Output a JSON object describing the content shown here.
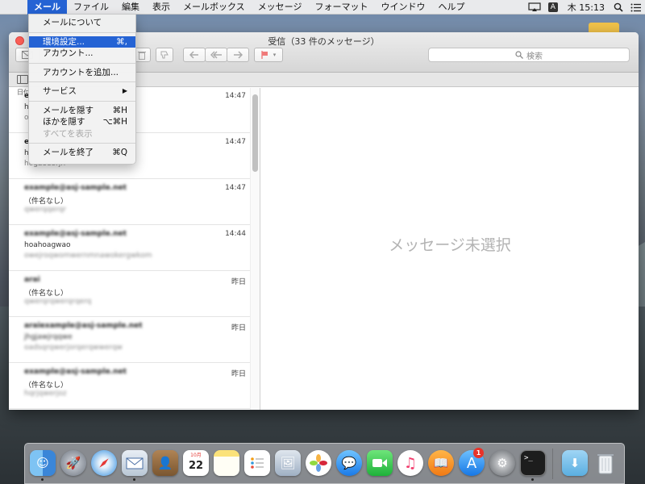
{
  "menubar": {
    "items": [
      "メール",
      "ファイル",
      "編集",
      "表示",
      "メールボックス",
      "メッセージ",
      "フォーマット",
      "ウインドウ",
      "ヘルプ"
    ],
    "ime": "A",
    "clock": "木 15:13"
  },
  "app_menu": {
    "items": [
      {
        "label": "メールについて",
        "shortcut": ""
      },
      {
        "label": "環境設定...",
        "shortcut": "⌘,"
      },
      {
        "label": "アカウント...",
        "shortcut": ""
      },
      {
        "label": "アカウントを追加...",
        "shortcut": ""
      },
      {
        "label": "サービス",
        "shortcut": "▶"
      },
      {
        "label": "メールを隠す",
        "shortcut": "⌘H"
      },
      {
        "label": "ほかを隠す",
        "shortcut": "⌥⌘H"
      },
      {
        "label": "すべてを表示",
        "shortcut": ""
      },
      {
        "label": "メールを終了",
        "shortcut": "⌘Q"
      }
    ]
  },
  "window": {
    "title": "受信（33 件のメッセージ）",
    "search_placeholder": "検索",
    "sort_label": "日付"
  },
  "messages": [
    {
      "from": "e",
      "subject": "h",
      "preview": "o",
      "time": "14:47"
    },
    {
      "from": "e",
      "subject": "h",
      "preview": "hogaoeorjrr",
      "time": "14:47"
    },
    {
      "from": "example@asj-sample.net",
      "subject": "（件名なし）",
      "preview": "qwerqqerqr",
      "time": "14:47"
    },
    {
      "from": "example@asj-sample.net",
      "subject": "hoahoagwao",
      "preview": "owejroqwomwernmnawokergwkom",
      "time": "14:44"
    },
    {
      "from": "arai",
      "subject": "（件名なし）",
      "preview": "qwerqrqwerqrqerq",
      "time": "昨日"
    },
    {
      "from": "araiexample@asj-sample.net",
      "subject": "jhgjawjrqqwe",
      "preview": "oadsqrqwerjorqerqwwerqw",
      "time": "昨日"
    },
    {
      "from": "example@asj-sample.net",
      "subject": "（件名なし）",
      "preview": "hqrjqwerjoz",
      "time": "昨日"
    }
  ],
  "reading_pane": {
    "empty_text": "メッセージ未選択"
  },
  "dock": {
    "calendar_day": "22",
    "calendar_month": "10月",
    "appstore_badge": "1"
  }
}
